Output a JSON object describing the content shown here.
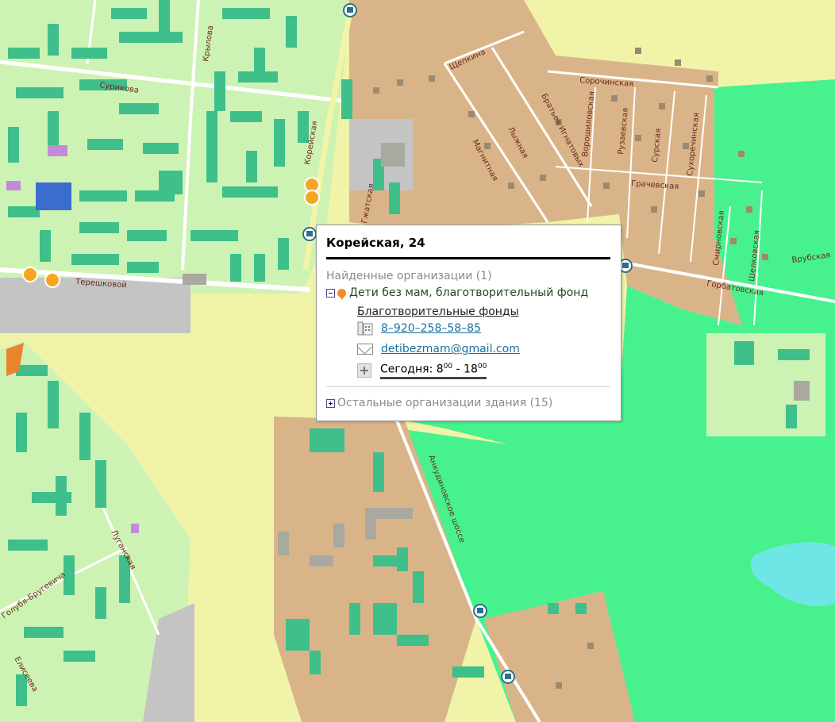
{
  "map": {
    "streets": [
      "Крылова",
      "Сурикова",
      "Терешковой",
      "Корейская",
      "Гжатская",
      "Щепкина",
      "Сорочинская",
      "Братьев Игнатовых",
      "Магнитная",
      "Лыжная",
      "Ворошиловская",
      "Рузаевская",
      "Сурская",
      "Сухоречинская",
      "Грачевская",
      "Смирновская",
      "Шелковская",
      "Врубская",
      "Горбатовская",
      "Анкудиновское шоссе",
      "Луганская",
      "Голубя-Бругевича",
      "Елисеева"
    ],
    "colors": {
      "residential": "#cdf3b4",
      "building": "#3fbf8a",
      "private_sector": "#dab489",
      "park": "#47f28e",
      "open_land": "#f0f3a8",
      "industrial": "#c4c4c4",
      "water": "#6fe6e6",
      "road": "#ffffff",
      "highway": "#f4f4a8"
    }
  },
  "popup": {
    "title": "Корейская, 24",
    "found_label": "Найденные организации (1)",
    "org_name": "Дети без мам, благотворительный фонд",
    "category": "Благотворительные фонды",
    "phone": "8–920–258–58–85",
    "email": "detibezmam@gmail.com",
    "hours_prefix": "Сегодня: 8",
    "hours_sup1": "00",
    "hours_mid": " - 18",
    "hours_sup2": "00",
    "others_label": "Остальные организации здания (15)"
  }
}
